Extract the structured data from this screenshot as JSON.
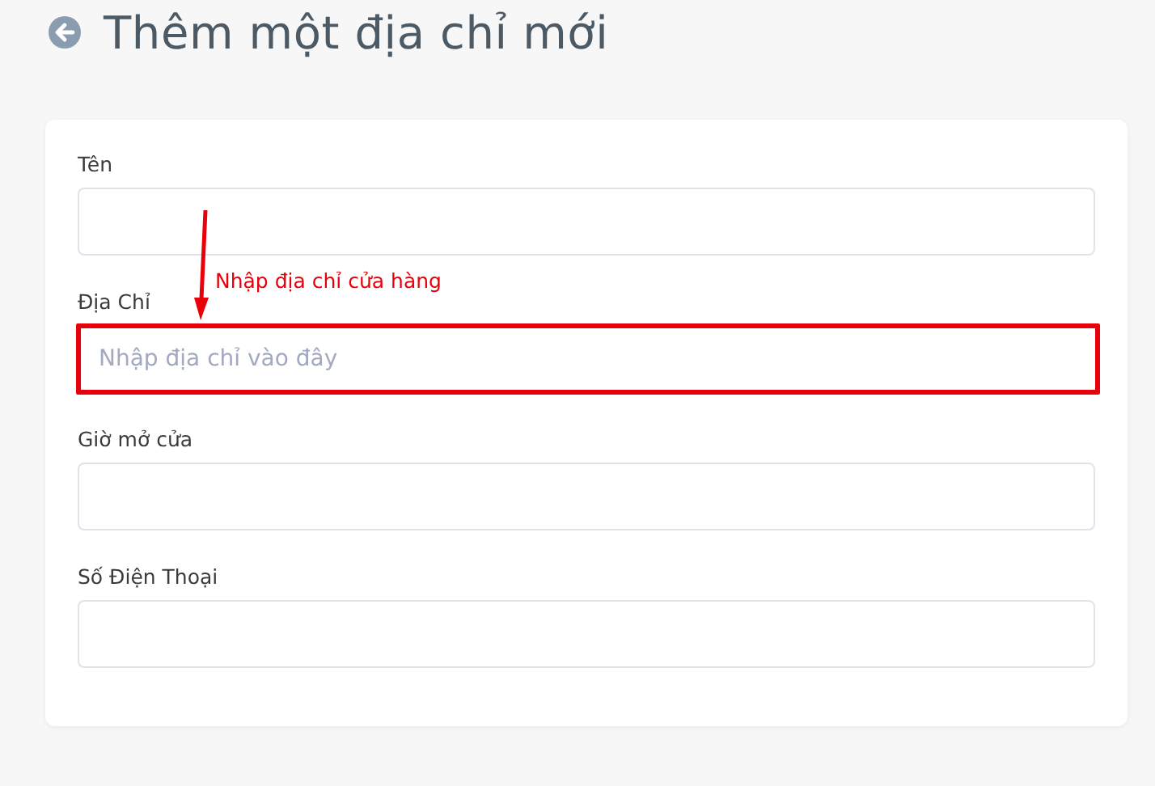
{
  "page": {
    "title": "Thêm một địa chỉ mới"
  },
  "fields": [
    {
      "label": "Tên",
      "highlighted": false
    },
    {
      "label": "Địa Chỉ",
      "placeholder": "Nhập địa chỉ vào đây",
      "highlighted": true
    },
    {
      "label": "Giờ mở cửa",
      "highlighted": false
    },
    {
      "label": "Số Điện Thoại",
      "highlighted": false
    }
  ],
  "annotation": {
    "text": "Nhập địa chỉ cửa hàng"
  }
}
